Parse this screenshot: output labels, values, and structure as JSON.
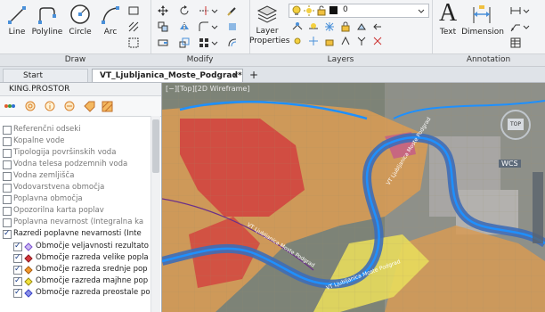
{
  "ribbon": {
    "draw": {
      "title": "Draw",
      "line": "Line",
      "polyline": "Polyline",
      "circle": "Circle",
      "arc": "Arc"
    },
    "modify": {
      "title": "Modify"
    },
    "layers": {
      "title": "Layers",
      "layer_properties_1": "Layer",
      "layer_properties_2": "Properties",
      "current_layer": "0"
    },
    "annotation": {
      "title": "Annotation",
      "text": "Text",
      "dimension": "Dimension"
    }
  },
  "tabs": {
    "start": "Start",
    "active": "VT_Ljubljanica_Moste_Podgrad*",
    "add": "+"
  },
  "left_panel": {
    "title": "KING.PROSTOR",
    "layers": [
      {
        "label": "Referenčni odseki",
        "checked": false
      },
      {
        "label": "Kopalne vode",
        "checked": false
      },
      {
        "label": "Tipologija površinskih voda",
        "checked": false
      },
      {
        "label": "Vodna telesa podzemnih voda",
        "checked": false
      },
      {
        "label": "Vodna zemljišča",
        "checked": false
      },
      {
        "label": "Vodovarstvena območja",
        "checked": false
      },
      {
        "label": "Poplavna območja",
        "checked": false
      },
      {
        "label": "Opozorilna karta poplav",
        "checked": false
      },
      {
        "label": "Poplavna nevarnost (Integralna ka",
        "checked": false
      },
      {
        "label": "Razredi poplavne nevarnosti (Inte",
        "checked": true
      }
    ],
    "sublayers": [
      {
        "label": "Območje veljavnosti rezultato",
        "checked": true,
        "color": "#7a4fd0"
      },
      {
        "label": "Območje razreda velike popla",
        "checked": true,
        "color": "#d6373c"
      },
      {
        "label": "Območje razreda srednje pop",
        "checked": true,
        "color": "#f29a2e"
      },
      {
        "label": "Območje razreda majhne pop",
        "checked": true,
        "color": "#f2e23c"
      },
      {
        "label": "Območje razreda preostale po",
        "checked": true,
        "color": "#3b44c9"
      }
    ]
  },
  "map": {
    "viewport_label": "[−][Top][2D Wireframe]",
    "river_label_1": "VT Ljubljanica Moste Podgrad",
    "river_label_2": "VT Ljubljanica Moste Podgrad",
    "river_label_3": "VT Ljubljanica Moste Podgrad",
    "compass": "TOP",
    "wcs": "WCS"
  }
}
